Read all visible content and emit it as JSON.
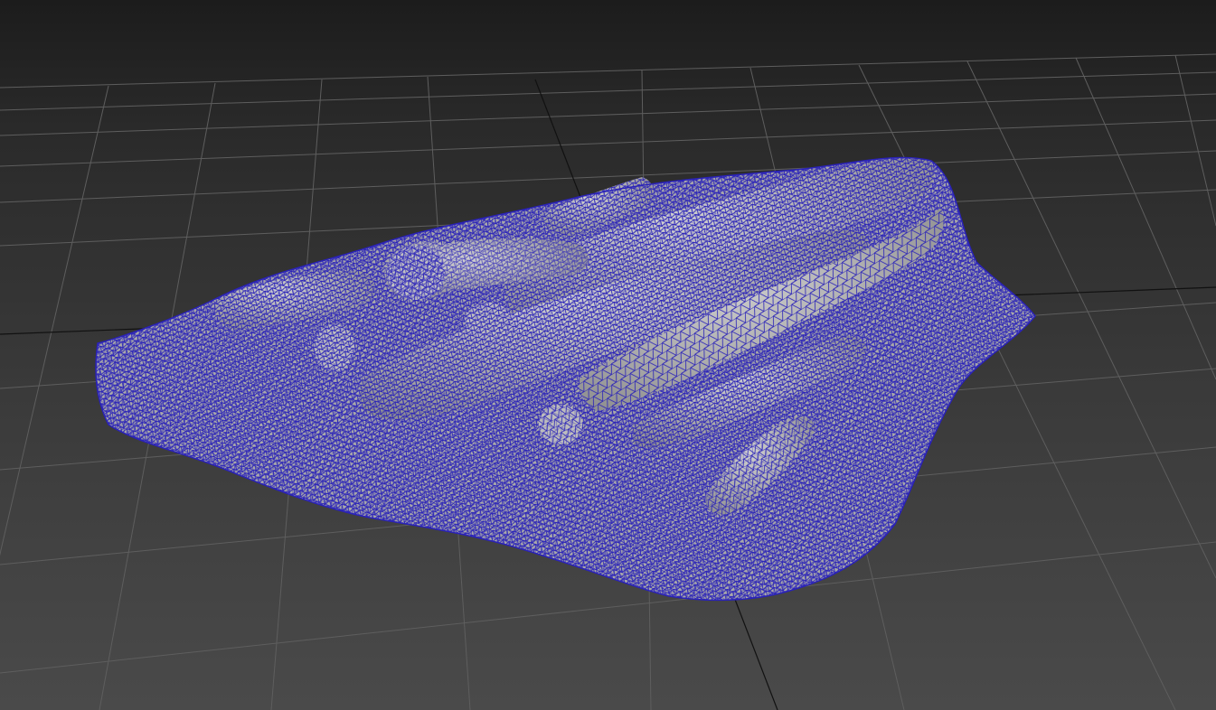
{
  "viewport": {
    "background_top": "#1c1c1c",
    "background_bottom": "#4a4a4a",
    "grid_color": "#5e5e5e",
    "grid_axis_color": "#111111",
    "mesh_surface_color": "#b4b4b4",
    "mesh_shadow_color": "#8c8c8c",
    "wire_color": "#2a22b8",
    "display_mode": "wireframe-on-shaded",
    "object": "log-pile-scan-mesh"
  }
}
